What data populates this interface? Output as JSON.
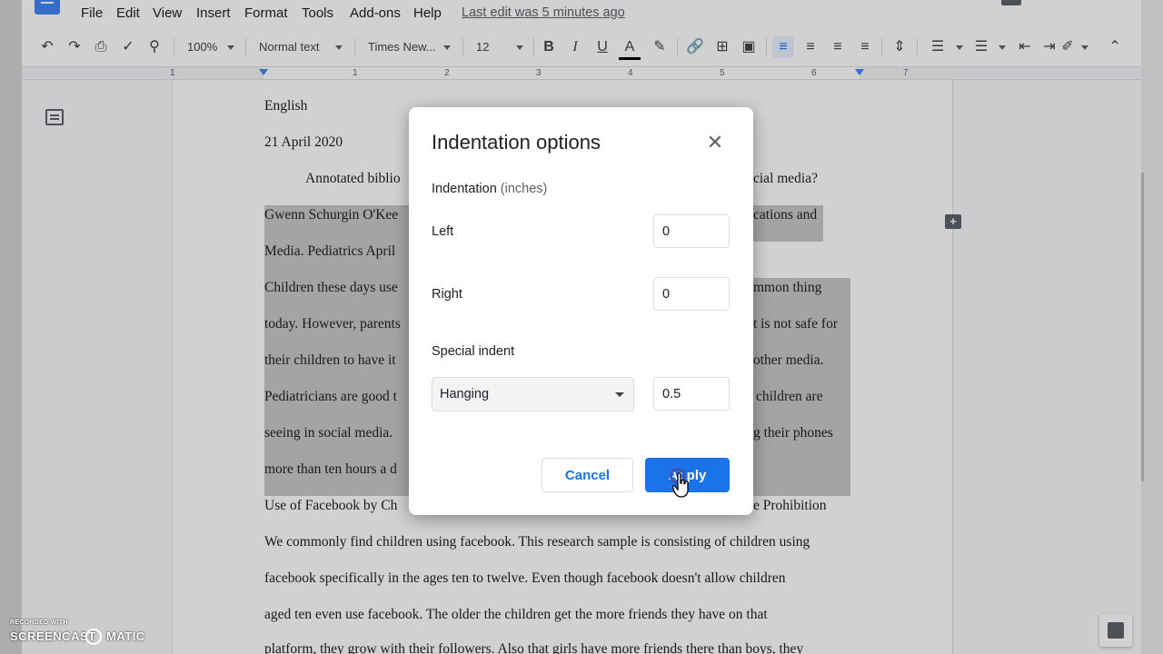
{
  "menu": {
    "items": [
      "File",
      "Edit",
      "View",
      "Insert",
      "Format",
      "Tools",
      "Add-ons",
      "Help"
    ],
    "last_edit": "Last edit was 5 minutes ago"
  },
  "toolbar": {
    "zoom": "100%",
    "style": "Normal text",
    "font": "Times New...",
    "font_size": "12"
  },
  "ruler": {
    "numbers": [
      "1",
      "1",
      "2",
      "3",
      "4",
      "5",
      "6",
      "7"
    ]
  },
  "document": {
    "lines": [
      "English",
      "21 April 2020",
      "Annotated biblio",
      "cial media?",
      "Gwenn Schurgin O'Kee",
      "cations and",
      "Media. Pediatrics April",
      "Children these days use",
      "mmon thing",
      "today. However, parents",
      "t is not safe for",
      "their children to have it",
      "other media.",
      "Pediatricians are good t",
      "children are",
      "seeing in social media.",
      "g their phones",
      "more than ten hours a d",
      "Use of Facebook by Ch",
      "e Prohibition",
      "We commonly find children using facebook. This research sample is consisting of children using",
      "facebook specifically in the ages ten to twelve. Even though facebook doesn't allow children",
      "aged ten even use facebook. The older the children get the more friends they have on that",
      "platform, they grow with their followers. Also that girls have more friends there than boys, they"
    ]
  },
  "dialog": {
    "title": "Indentation options",
    "section": "Indentation",
    "section_unit": "(inches)",
    "left_label": "Left",
    "left_value": "0",
    "right_label": "Right",
    "right_value": "0",
    "special_label": "Special indent",
    "special_option": "Hanging",
    "special_value": "0.5",
    "cancel": "Cancel",
    "apply": "Apply"
  },
  "watermark": {
    "top": "RECORDED WITH",
    "left": "SCREENCAST",
    "right": "MATIC"
  }
}
